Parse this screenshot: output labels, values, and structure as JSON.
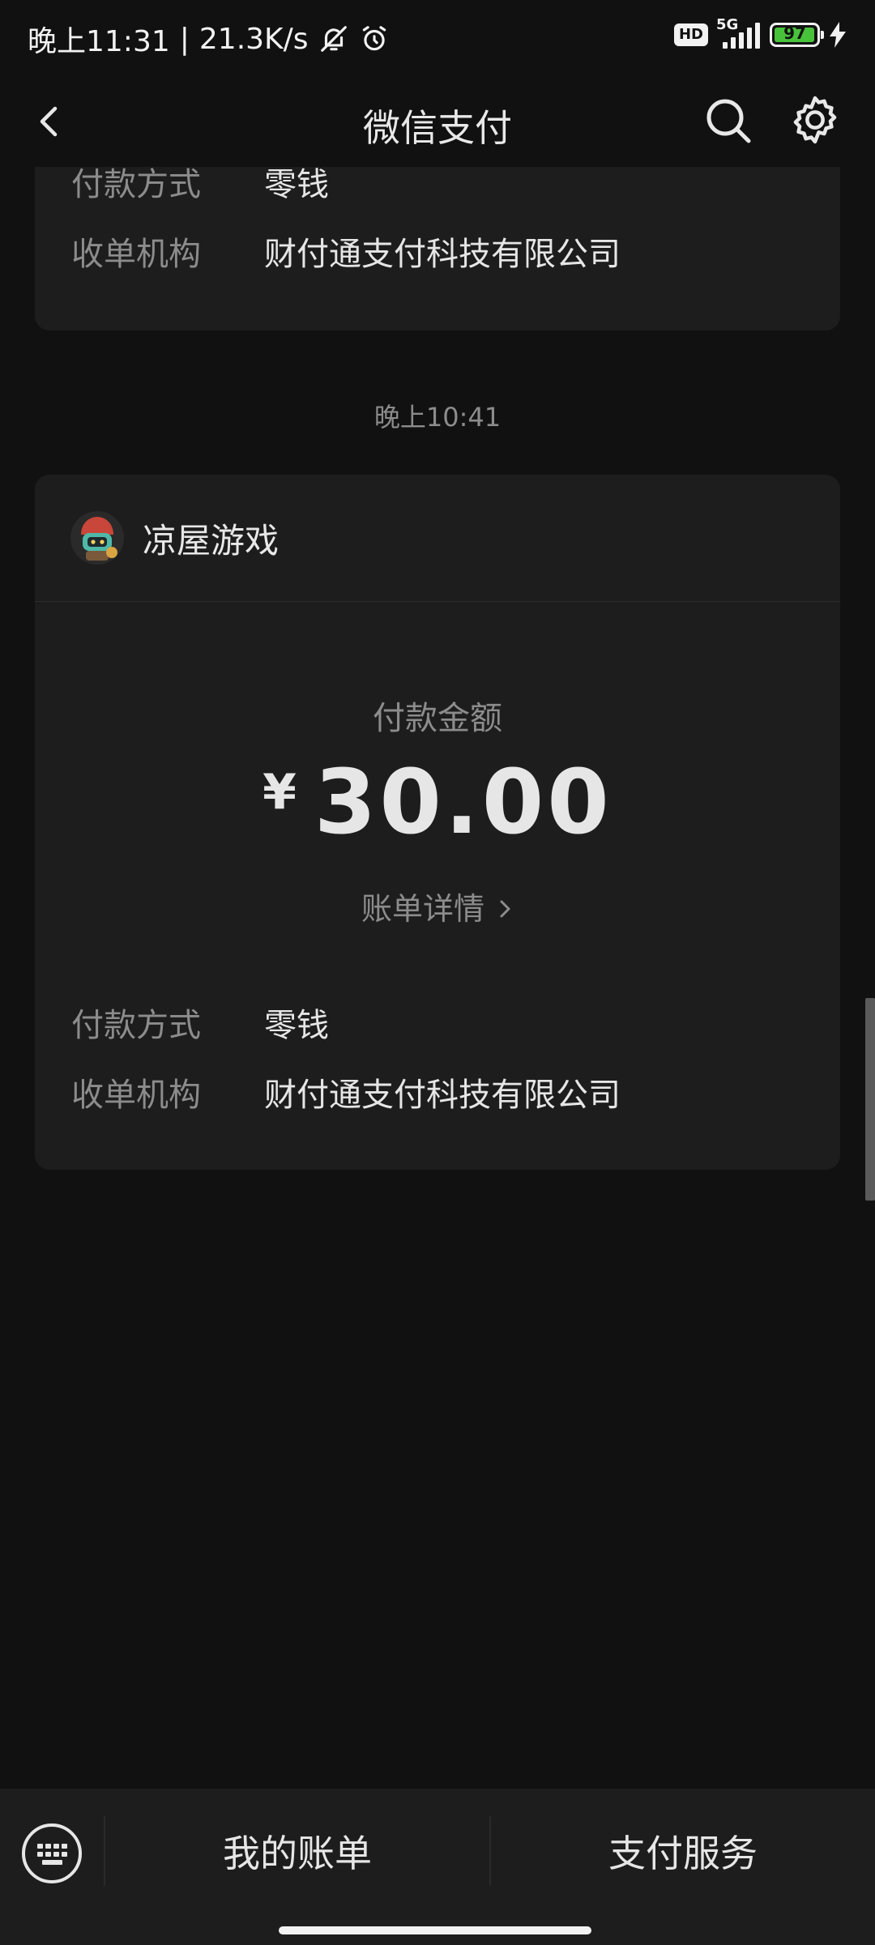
{
  "status_bar": {
    "time": "晚上11:31",
    "separator": "|",
    "net_speed": "21.3K/s",
    "hd_label": "HD",
    "network_type": "5G",
    "battery_percent": "97",
    "battery_level": 0.97,
    "icons": [
      "bell-off-icon",
      "alarm-icon",
      "signal-icon",
      "battery-icon",
      "charging-icon"
    ]
  },
  "nav": {
    "title": "微信支付",
    "back_icon": "chevron-left-icon",
    "search_icon": "search-icon",
    "settings_icon": "gear-icon"
  },
  "previous_card": {
    "rows": [
      {
        "key": "付款方式",
        "value": "零钱"
      },
      {
        "key": "收单机构",
        "value": "财付通支付科技有限公司"
      }
    ]
  },
  "timestamp": "晚上10:41",
  "payment_card": {
    "merchant_name": "凉屋游戏",
    "amount_label": "付款金额",
    "currency": "¥",
    "amount": "30.00",
    "detail_link": "账单详情",
    "rows": [
      {
        "key": "付款方式",
        "value": "零钱"
      },
      {
        "key": "收单机构",
        "value": "财付通支付科技有限公司"
      }
    ]
  },
  "bottom_bar": {
    "keyboard_icon": "keyboard-icon",
    "items": [
      "我的账单",
      "支付服务"
    ]
  },
  "colors": {
    "background": "#111111",
    "card": "#1d1d1d",
    "text_primary": "#e6e6e6",
    "text_secondary": "#8c8c8c",
    "battery_fill": "#49c23b"
  }
}
